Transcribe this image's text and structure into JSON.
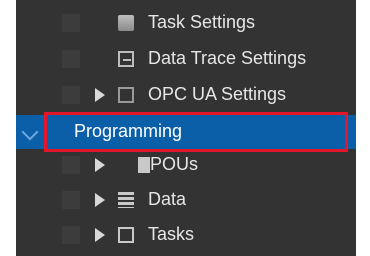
{
  "tree": {
    "items": [
      {
        "label": "Task Settings",
        "icon": "task-settings-icon"
      },
      {
        "label": "Data Trace Settings",
        "icon": "data-trace-icon"
      },
      {
        "label": "OPC UA Settings",
        "icon": "opc-ua-icon",
        "expandable": true
      },
      {
        "label": "Programming",
        "selected": true
      },
      {
        "label": "POUs",
        "icon": "pou-icon",
        "expandable": true
      },
      {
        "label": "Data",
        "icon": "data-icon",
        "expandable": true
      },
      {
        "label": "Tasks",
        "icon": "tasks-icon",
        "expandable": true
      }
    ]
  },
  "colors": {
    "panel_bg": "#333333",
    "selection_bg": "#0a5fa8",
    "highlight_border": "#e3172c"
  }
}
